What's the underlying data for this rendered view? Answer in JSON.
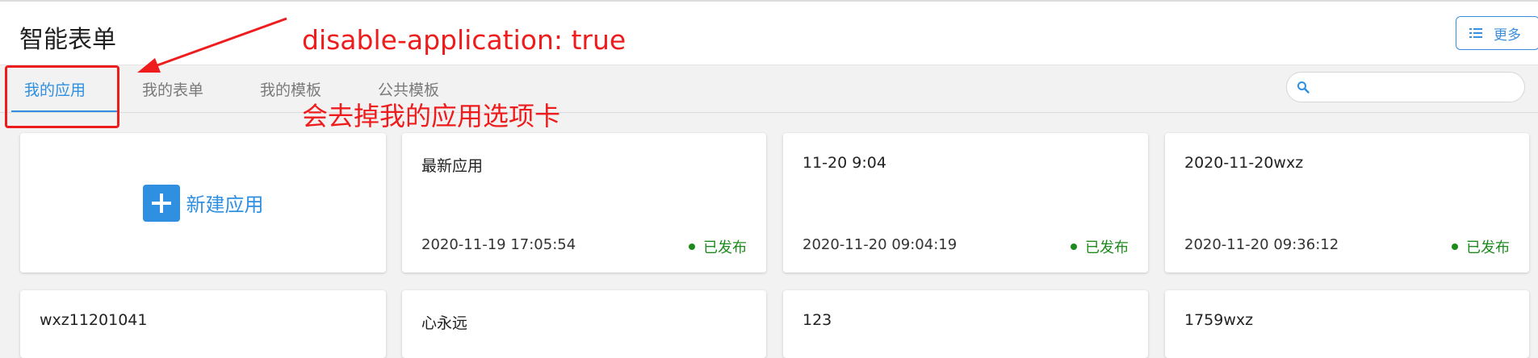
{
  "header": {
    "title": "智能表单",
    "more_label": "更多"
  },
  "tabs": [
    {
      "label": "我的应用",
      "active": true
    },
    {
      "label": "我的表单",
      "active": false
    },
    {
      "label": "我的模板",
      "active": false
    },
    {
      "label": "公共模板",
      "active": false
    }
  ],
  "search": {
    "placeholder": "",
    "icon": "search-icon"
  },
  "new_app": {
    "label": "新建应用",
    "icon": "plus-icon"
  },
  "apps": [
    {
      "title": "最新应用",
      "time": "2020-11-19 17:05:54",
      "status": "已发布"
    },
    {
      "title": "11-20 9:04",
      "time": "2020-11-20 09:04:19",
      "status": "已发布"
    },
    {
      "title": "2020-11-20wxz",
      "time": "2020-11-20 09:36:12",
      "status": "已发布"
    },
    {
      "title": "wxz11201041",
      "time": "",
      "status": ""
    },
    {
      "title": "心永远",
      "time": "",
      "status": ""
    },
    {
      "title": "123",
      "time": "",
      "status": ""
    },
    {
      "title": "1759wxz",
      "time": "",
      "status": ""
    }
  ],
  "annotations": {
    "top": "disable-application: true",
    "bottom": "会去掉我的应用选项卡"
  },
  "colors": {
    "accent": "#2f8fe0",
    "published": "#1e8a1e",
    "annotation": "#ee1c1c"
  }
}
